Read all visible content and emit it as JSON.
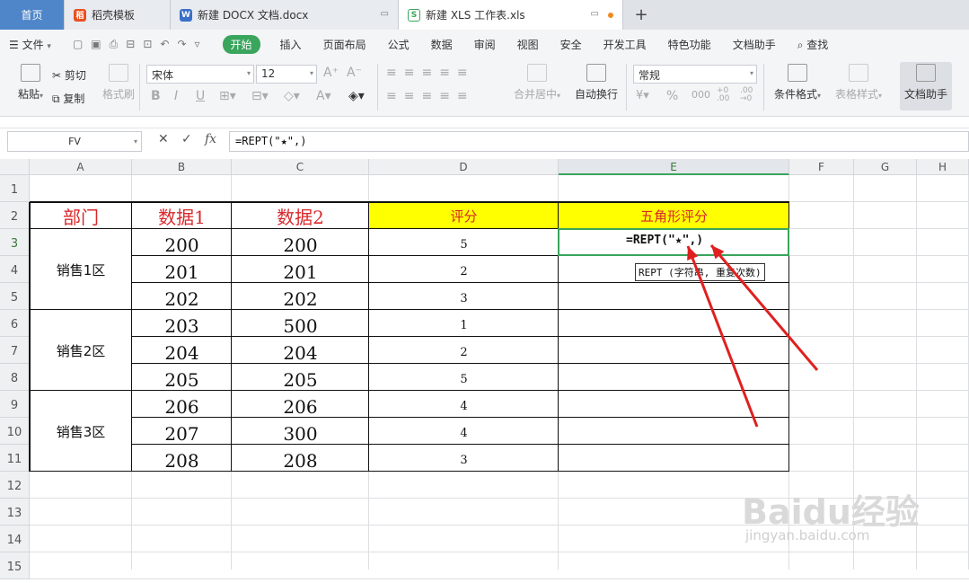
{
  "tabs": [
    {
      "label": "首页"
    },
    {
      "label": "稻壳模板"
    },
    {
      "label": "新建 DOCX 文档.docx"
    },
    {
      "label": "新建 XLS 工作表.xls"
    }
  ],
  "tab_add": "+",
  "menu": {
    "file": "文件",
    "items": [
      "开始",
      "插入",
      "页面布局",
      "公式",
      "数据",
      "审阅",
      "视图",
      "安全",
      "开发工具",
      "特色功能",
      "文档助手"
    ],
    "search": "查找"
  },
  "ribbon": {
    "paste": "粘贴",
    "cut": "剪切",
    "copy": "复制",
    "format_painter": "格式刷",
    "font_name": "宋体",
    "font_size": "12",
    "merge_center": "合并居中",
    "wrap": "自动换行",
    "number_format": "常规",
    "cond_format": "条件格式",
    "table_style": "表格样式",
    "doc_assistant": "文档助手"
  },
  "formula_bar": {
    "name_box": "FV",
    "formula": "=REPT(\"★\",)"
  },
  "columns": [
    "A",
    "B",
    "C",
    "D",
    "E",
    "F",
    "G",
    "H"
  ],
  "rows": [
    "1",
    "2",
    "3",
    "4",
    "5",
    "6",
    "7",
    "8",
    "9",
    "10",
    "11",
    "12",
    "13",
    "14",
    "15"
  ],
  "table": {
    "headers": [
      "部门",
      "数据1",
      "数据2",
      "评分",
      "五角形评分"
    ],
    "depts": [
      "销售1区",
      "销售2区",
      "销售3区"
    ],
    "data1": [
      "200",
      "201",
      "202",
      "203",
      "204",
      "205",
      "206",
      "207",
      "208"
    ],
    "data2": [
      "200",
      "201",
      "202",
      "500",
      "204",
      "205",
      "206",
      "300",
      "208"
    ],
    "scores": [
      "5",
      "2",
      "3",
      "1",
      "2",
      "5",
      "4",
      "4",
      "3"
    ]
  },
  "active_cell_text": "=REPT(\"★\",)",
  "tooltip": "REPT (字符串, 重复次数)",
  "watermark": {
    "main": "Baidu经验",
    "sub": "jingyan.baidu.com"
  },
  "colors": {
    "accent_green": "#3aa55d",
    "header_red": "#d9282c",
    "header_yellow": "#ffff00",
    "arrow_red": "#e02020"
  }
}
